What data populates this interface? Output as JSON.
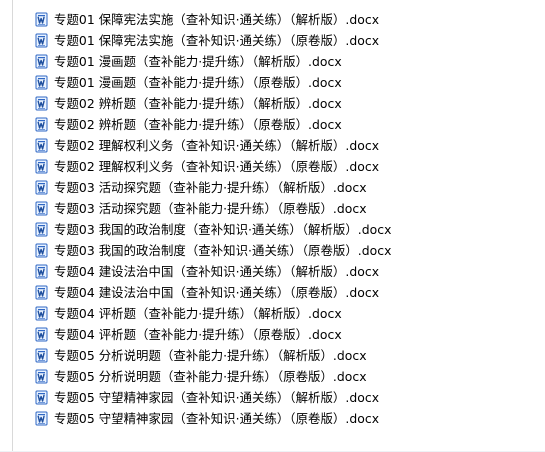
{
  "icon": "word-document-icon",
  "colors": {
    "icon_blue": "#2f67c4",
    "icon_dark": "#1f4f9e",
    "icon_light": "#eaf3ff"
  },
  "files": [
    {
      "name": "专题01 保障宪法实施（查补知识·通关练）（解析版）.docx"
    },
    {
      "name": "专题01 保障宪法实施（查补知识·通关练）（原卷版）.docx"
    },
    {
      "name": "专题01 漫画题（查补能力·提升练）（解析版）.docx"
    },
    {
      "name": "专题01 漫画题（查补能力·提升练）（原卷版）.docx"
    },
    {
      "name": "专题02 辨析题（查补能力·提升练）（解析版）.docx"
    },
    {
      "name": "专题02 辨析题（查补能力·提升练）（原卷版）.docx"
    },
    {
      "name": "专题02 理解权利义务（查补知识·通关练）（解析版）.docx"
    },
    {
      "name": "专题02 理解权利义务（查补知识·通关练）（原卷版）.docx"
    },
    {
      "name": "专题03 活动探究题（查补能力·提升练）（解析版）.docx"
    },
    {
      "name": "专题03 活动探究题（查补能力·提升练）（原卷版）.docx"
    },
    {
      "name": "专题03 我国的政治制度（查补知识·通关练）（解析版）.docx"
    },
    {
      "name": "专题03 我国的政治制度（查补知识·通关练）（原卷版）.docx"
    },
    {
      "name": "专题04 建设法治中国（查补知识·通关练）（解析版）.docx"
    },
    {
      "name": "专题04 建设法治中国（查补知识·通关练）（原卷版）.docx"
    },
    {
      "name": "专题04 评析题（查补能力·提升练）（解析版）.docx"
    },
    {
      "name": "专题04 评析题（查补能力·提升练）（原卷版）.docx"
    },
    {
      "name": "专题05 分析说明题（查补能力·提升练）（解析版）.docx"
    },
    {
      "name": "专题05 分析说明题（查补能力·提升练）（原卷版）.docx"
    },
    {
      "name": "专题05 守望精神家园（查补知识·通关练）（解析版）.docx"
    },
    {
      "name": "专题05 守望精神家园（查补知识·通关练）（原卷版）.docx"
    }
  ]
}
